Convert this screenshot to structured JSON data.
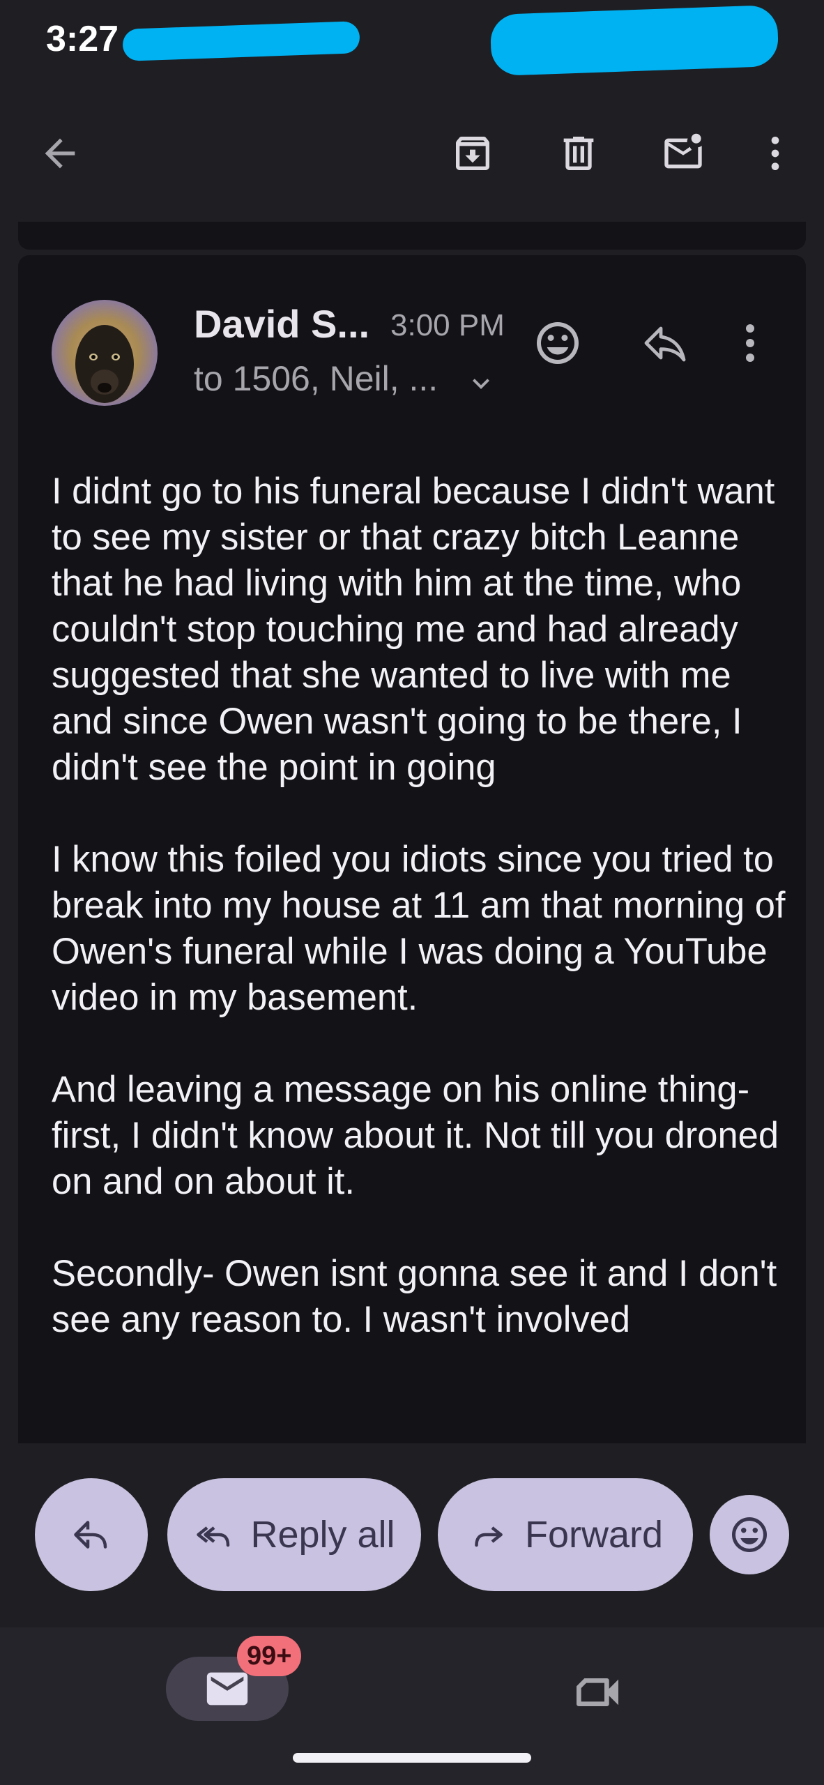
{
  "status_bar": {
    "time": "3:27"
  },
  "toolbar": {
    "icons": [
      "back-arrow-icon",
      "archive-icon",
      "delete-icon",
      "mark-unread-icon",
      "more-vert-icon"
    ]
  },
  "email": {
    "sender_name": "David S...",
    "time": "3:00 PM",
    "recipients": "to 1506, Neil, ...",
    "paragraphs": [
      "I didnt go to his funeral because I didn't want to see my sister or that crazy bitch Leanne that he had living with him at the time, who couldn't stop touching me and had already suggested that she wanted to live with me and since Owen wasn't going to be there, I didn't see the point in going",
      "I know this foiled you idiots since you tried to break into my house at 11 am that morning of Owen's funeral while I was doing a YouTube video in my basement.",
      "And leaving a message on his online thing- first, I didn't know about it. Not till you droned on and on about it.",
      "Secondly- Owen isnt gonna see it and I don't see any reason to. I wasn't involved"
    ]
  },
  "actions": {
    "reply_all_label": "Reply all",
    "forward_label": "Forward"
  },
  "bottom_nav": {
    "mail_badge": "99+"
  },
  "colors": {
    "background": "#1f1f23",
    "card": "#131217",
    "pill": "#c9c2e0",
    "badge": "#f2707a",
    "redaction": "#00b2f2"
  }
}
